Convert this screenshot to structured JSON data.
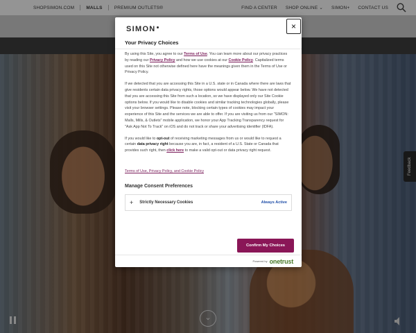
{
  "nav": {
    "left": [
      "SHOPSIMON.COM",
      "MALLS",
      "PREMIUM OUTLETS®"
    ],
    "right": [
      "FIND A CENTER",
      "SHOP ONLINE",
      "SIMON+",
      "CONTACT US"
    ],
    "search_icon": "search-icon"
  },
  "feedback_tab": "Feedback",
  "modal": {
    "logo": "SIMON",
    "close": "×",
    "title": "Your Privacy Choices",
    "p1_a": "By using this Site, you agree to our ",
    "p1_link1": "Terms of Use",
    "p1_b": ". You can learn more about our privacy practices by reading our ",
    "p1_link2": "Privacy Policy",
    "p1_c": " and how we use cookies at our ",
    "p1_link3": "Cookie Policy",
    "p1_d": ". Capitalized terms used on this Site not otherwise defined here have the meanings given them in the Terms of Use or Privacy Policy.",
    "p2": "If we detected that you are accessing this Site in a U.S. state or in Canada where there are laws that give residents certain data privacy rights, those options would appear below. We have not detected that you are accessing this Site from such a location, so we have displayed only our Site Cookie options below. If you would like to disable cookies and similar tracking technologies globally, please visit your browser settings. Please note, blocking certain types of cookies may impact your experience of this Site and the services we are able to offer. If you are visiting us from our \"SIMON: Malls, Mills, & Outlets\" mobile application, we honor your App Tracking Transparency request for \"Ask App Not To Track\" on iOS and do not track or share your advertising identifier (IDFA).",
    "p3_a": "If you would like to ",
    "p3_b1": "opt-out",
    "p3_c": " of receiving marketing messages from us or would like to request a certain ",
    "p3_b2": "data privacy right",
    "p3_d": " because you are, in fact, a resident of a U.S. State or Canada that provides such right, then ",
    "p3_link": "click here",
    "p3_e": " to make a valid opt-out or data privacy right request.",
    "policy_link": "Terms of Use, Privacy Policy, and Cookie Policy",
    "consent_title": "Manage Consent Preferences",
    "consent_item": "Strictly Necessary Cookies",
    "consent_status": "Always Active",
    "confirm_button": "Confirm My Choices",
    "powered_by": "Powered by",
    "brand": "onetrust"
  }
}
